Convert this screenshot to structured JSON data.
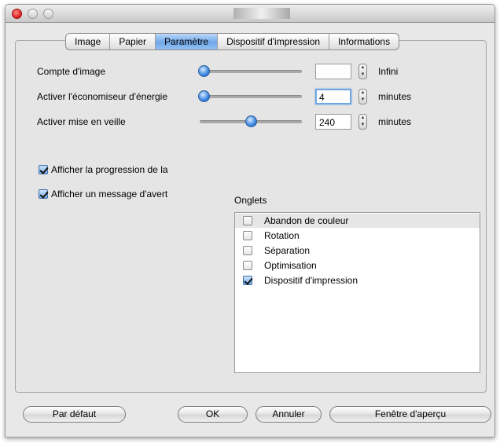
{
  "tabs": [
    {
      "label": "Image"
    },
    {
      "label": "Papier"
    },
    {
      "label": "Paramètre"
    },
    {
      "label": "Dispositif d'impression"
    },
    {
      "label": "Informations"
    }
  ],
  "settings": {
    "image_count": {
      "label": "Compte d'image",
      "value": "",
      "unit": "Infini",
      "level": 0
    },
    "energy_saver": {
      "label": "Activer l'économiseur d'énergie",
      "value": "4",
      "unit": "minutes",
      "level": 0
    },
    "sleep": {
      "label": "Activer mise en veille",
      "value": "240",
      "unit": "minutes",
      "level": 0.5
    }
  },
  "checkboxes": {
    "show_progress": {
      "label": "Afficher la progression de la",
      "checked": true
    },
    "show_warning": {
      "label": "Afficher un message d'avert",
      "checked": true
    }
  },
  "onglets": {
    "title": "Onglets",
    "items": [
      {
        "label": "Abandon de couleur",
        "checked": false,
        "selected": true
      },
      {
        "label": "Rotation",
        "checked": false
      },
      {
        "label": "Séparation",
        "checked": false
      },
      {
        "label": "Optimisation",
        "checked": false
      },
      {
        "label": "Dispositif d'impression",
        "checked": true
      }
    ]
  },
  "buttons": {
    "default": "Par défaut",
    "ok": "OK",
    "cancel": "Annuler",
    "preview": "Fenêtre d'aperçu"
  },
  "colors": {
    "accent": "#3a86e0",
    "tab_active": "#6ea7e8",
    "window_bg": "#e8e8e8"
  }
}
